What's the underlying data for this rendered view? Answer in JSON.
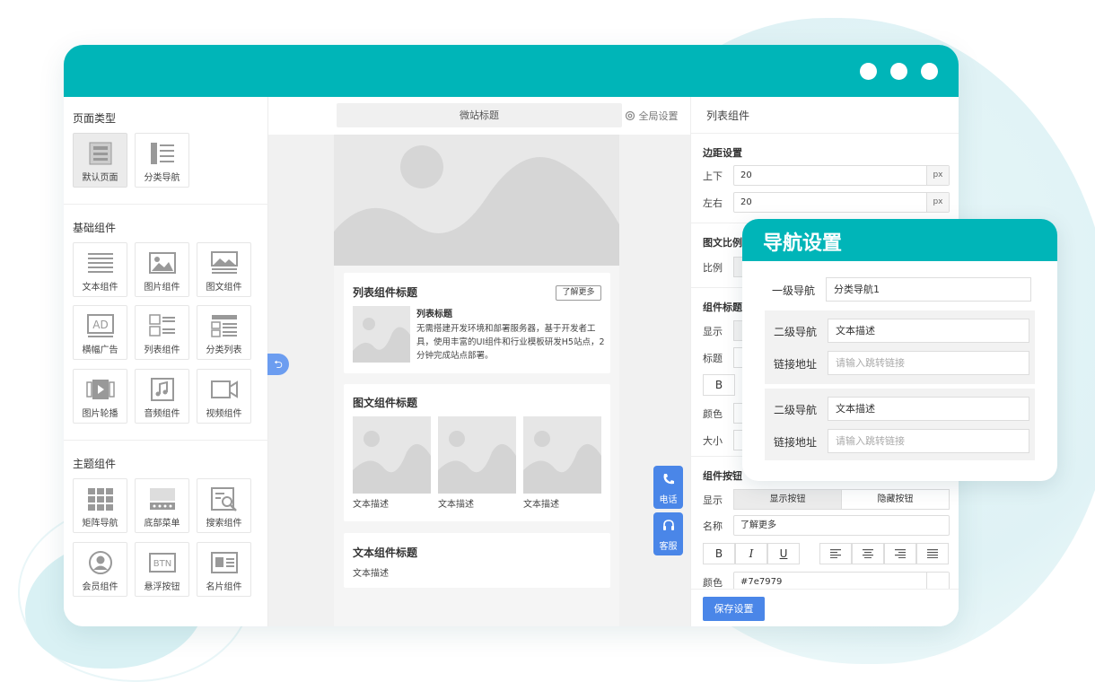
{
  "colors": {
    "brand": "#00b5b8",
    "primary_button": "#4a86e8",
    "placeholder_fill": "#e6e6e6"
  },
  "left_panel": {
    "page_type_title": "页面类型",
    "page_types": [
      {
        "label": "默认页面",
        "icon": "default-page-icon",
        "selected": true
      },
      {
        "label": "分类导航",
        "icon": "category-nav-icon",
        "selected": false
      }
    ],
    "basic_title": "基础组件",
    "basic_components": [
      {
        "label": "文本组件",
        "icon": "text-lines-icon"
      },
      {
        "label": "图片组件",
        "icon": "image-icon"
      },
      {
        "label": "图文组件",
        "icon": "image-text-icon"
      },
      {
        "label": "横幅广告",
        "icon": "ad-banner-icon"
      },
      {
        "label": "列表组件",
        "icon": "list-icon"
      },
      {
        "label": "分类列表",
        "icon": "category-list-icon"
      },
      {
        "label": "图片轮播",
        "icon": "carousel-icon"
      },
      {
        "label": "音频组件",
        "icon": "music-note-icon"
      },
      {
        "label": "视频组件",
        "icon": "video-camera-icon"
      }
    ],
    "theme_title": "主题组件",
    "theme_components": [
      {
        "label": "矩阵导航",
        "icon": "grid-icon"
      },
      {
        "label": "底部菜单",
        "icon": "bottom-menu-icon"
      },
      {
        "label": "搜索组件",
        "icon": "search-icon"
      },
      {
        "label": "会员组件",
        "icon": "member-avatar-icon"
      },
      {
        "label": "悬浮按钮",
        "icon": "btn-icon",
        "icon_text": "BTN"
      },
      {
        "label": "名片组件",
        "icon": "business-card-icon"
      }
    ]
  },
  "preview": {
    "site_title": "微站标题",
    "global_settings": "全局设置",
    "list_card": {
      "title": "列表组件标题",
      "more": "了解更多",
      "item_title": "列表标题",
      "item_desc": "无需搭建开发环境和部署服务器，基于开发者工具，使用丰富的UI组件和行业模板研发H5站点，2分钟完成站点部署。"
    },
    "image_text_card": {
      "title": "图文组件标题",
      "captions": [
        "文本描述",
        "文本描述",
        "文本描述"
      ]
    },
    "text_card": {
      "title": "文本组件标题",
      "desc": "文本描述"
    },
    "float_buttons": [
      {
        "label": "电话",
        "icon": "phone-icon"
      },
      {
        "label": "客服",
        "icon": "headset-icon"
      }
    ],
    "collapse_icon": "collapse-arrow-icon"
  },
  "right_panel": {
    "title": "列表组件",
    "margin_title": "边距设置",
    "margin_tb_label": "上下",
    "margin_tb_value": "20",
    "margin_lr_label": "左右",
    "margin_lr_value": "20",
    "unit": "px",
    "ratio_title": "图文比例",
    "ratio_label": "比例",
    "comp_title_section": "组件标题",
    "show_label": "显示",
    "title_label": "标题",
    "bold": "B",
    "color_label": "颜色",
    "size_label": "大小",
    "button_section": "组件按钮",
    "show_button": "显示按钮",
    "hide_button": "隐藏按钮",
    "name_label": "名称",
    "name_value": "了解更多",
    "italic": "I",
    "underline": "U",
    "color_value": "#7e7979",
    "save": "保存设置"
  },
  "nav_popup": {
    "title": "导航设置",
    "level1_label": "一级导航",
    "level1_value": "分类导航1",
    "groups": [
      {
        "level2_label": "二级导航",
        "level2_value": "文本描述",
        "link_label": "链接地址",
        "link_placeholder": "请输入跳转链接"
      },
      {
        "level2_label": "二级导航",
        "level2_value": "文本描述",
        "link_label": "链接地址",
        "link_placeholder": "请输入跳转链接"
      }
    ]
  }
}
